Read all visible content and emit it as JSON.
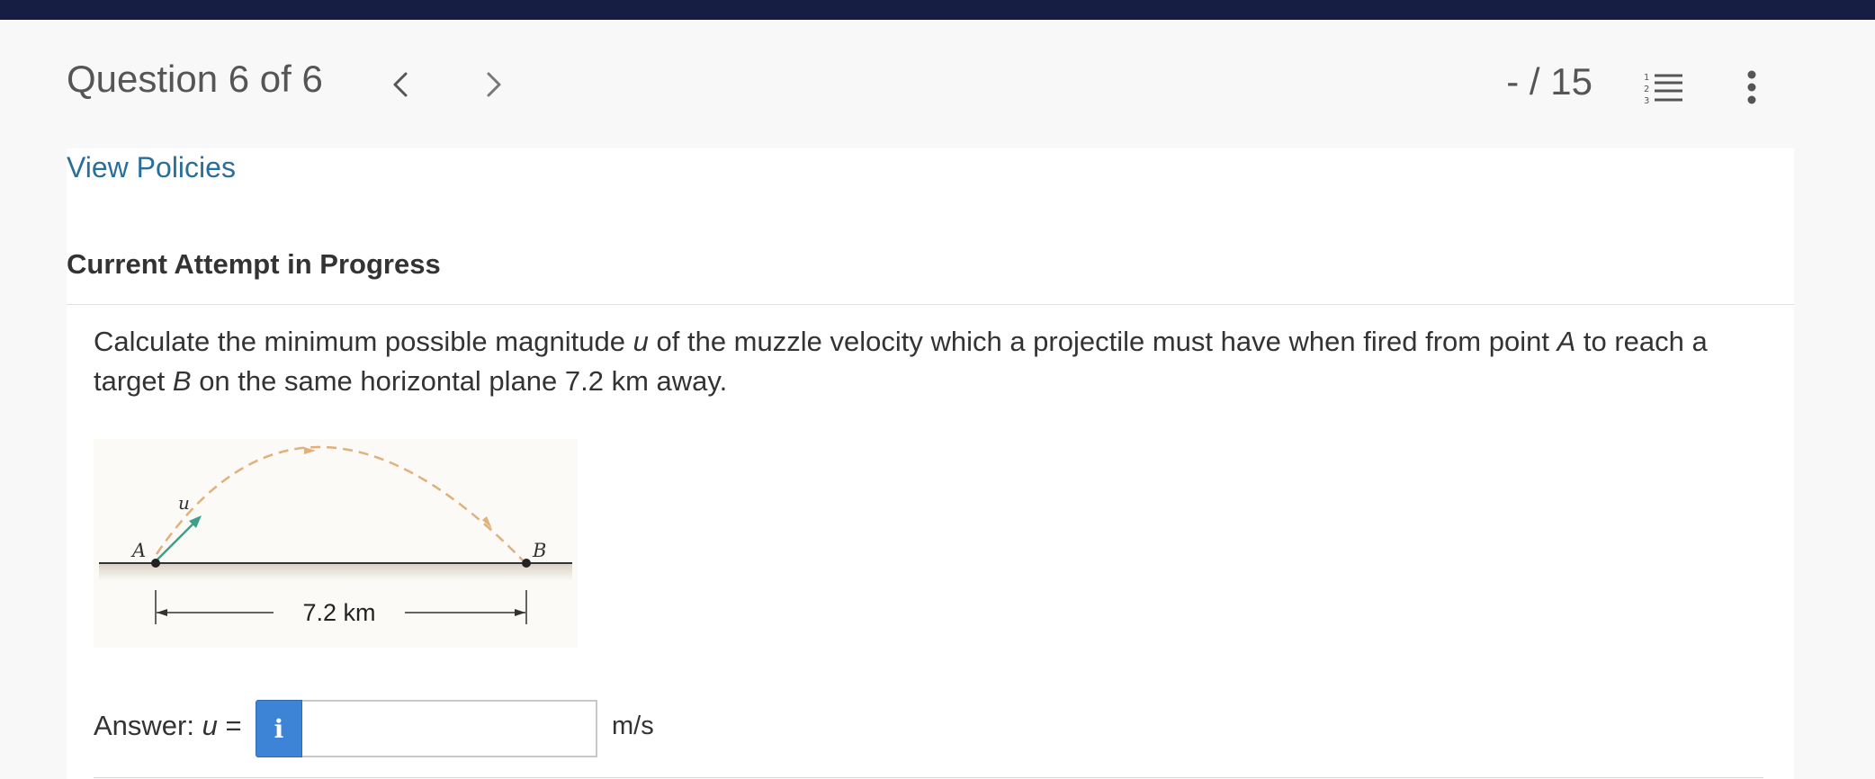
{
  "header": {
    "question_title": "Question 6 of 6",
    "score": "- / 15",
    "prev_icon": "chevron-left-icon",
    "next_icon": "chevron-right-icon",
    "list_icon": "numbered-list-icon",
    "more_icon": "vertical-ellipsis-icon"
  },
  "policies_link": "View Policies",
  "attempt_heading": "Current Attempt in Progress",
  "question": {
    "part1": "Calculate the minimum possible magnitude ",
    "u": "u",
    "part2": " of the muzzle velocity which a projectile must have when fired from point ",
    "a": "A",
    "part3": " to reach a target ",
    "b": "B",
    "part4": " on the same horizontal plane 7.2 km away."
  },
  "figure": {
    "label_u": "u",
    "label_a": "A",
    "label_b": "B",
    "distance": "7.2 km"
  },
  "answer": {
    "label_prefix": "Answer: ",
    "label_var": "u",
    "label_eq": " =",
    "info_icon": "i",
    "value": "",
    "unit": "m/s"
  },
  "colors": {
    "top_bar": "#161f43",
    "link": "#2a6f9a",
    "info_button": "#3d84d6",
    "trajectory": "#e2b07a",
    "velocity_arrow": "#3aa08a"
  }
}
